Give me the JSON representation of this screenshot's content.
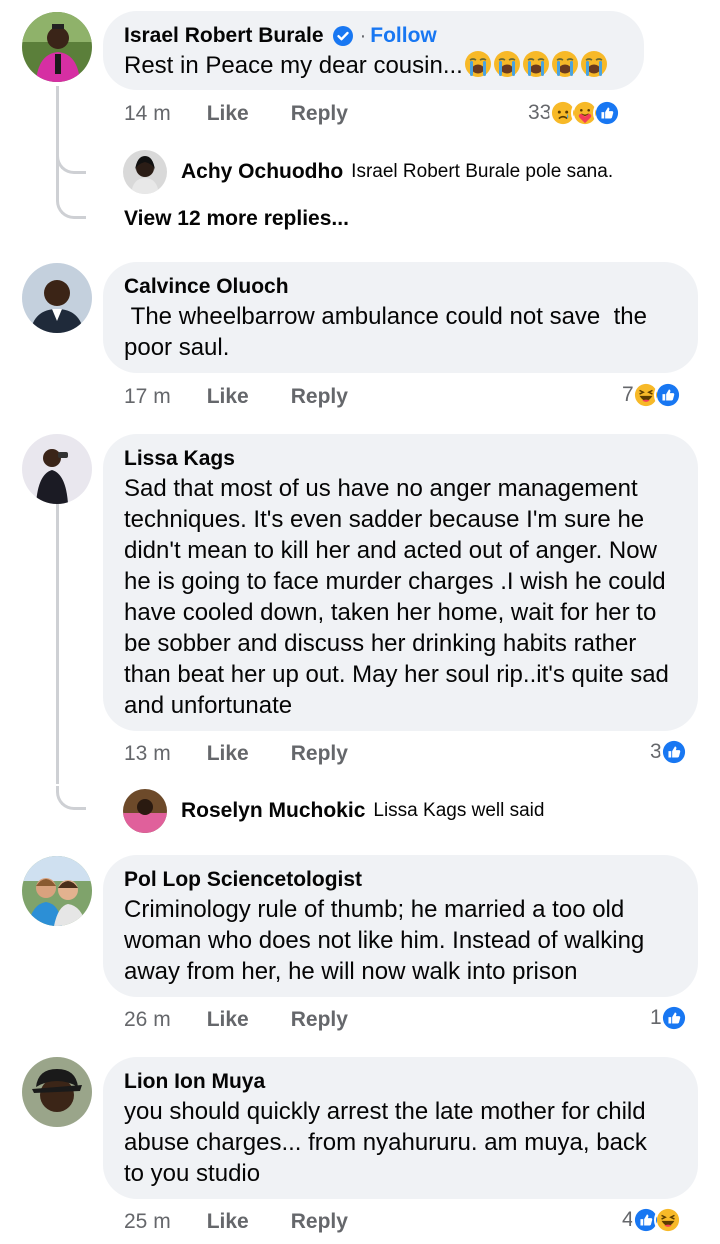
{
  "comments": [
    {
      "author": "Israel Robert Burale",
      "follow_label": "Follow",
      "separator": "·",
      "text": "Rest in Peace my dear cousin...",
      "inline_emoji": [
        "crying-face",
        "crying-face",
        "crying-face",
        "crying-face",
        "crying-face"
      ],
      "time": "14 m",
      "like": "Like",
      "reply": "Reply",
      "reaction_count": "33",
      "reactions": [
        "sad",
        "care",
        "like"
      ],
      "replies": [
        {
          "author": "Achy Ochuodho",
          "text": "Israel Robert Burale pole sana."
        }
      ],
      "view_more": "View 12 more replies..."
    },
    {
      "author": "Calvince Oluoch",
      "text": " The wheelbarrow ambulance could not save  the poor saul.",
      "time": "17 m",
      "like": "Like",
      "reply": "Reply",
      "reaction_count": "7",
      "reactions": [
        "haha",
        "like"
      ]
    },
    {
      "author": "Lissa Kags",
      "text": "Sad that most of us have no anger management techniques. It's even sadder because I'm sure he didn't mean to kill her and acted out of anger. Now he is going to face murder charges .I wish he could have cooled down, taken her home, wait for her to be sobber and discuss her drinking habits rather than beat her up out. May her soul rip..it's quite sad and unfortunate",
      "time": "13 m",
      "like": "Like",
      "reply": "Reply",
      "reaction_count": "3",
      "reactions": [
        "like"
      ],
      "replies": [
        {
          "author": "Roselyn Muchokic",
          "text": "Lissa Kags well said"
        }
      ]
    },
    {
      "author": "Pol Lop Sciencetologist",
      "text": "Criminology rule of thumb; he married a too old woman who does not like him. Instead of walking away from her, he will now walk into prison",
      "time": "26 m",
      "like": "Like",
      "reply": "Reply",
      "reaction_count": "1",
      "reactions": [
        "like"
      ]
    },
    {
      "author": "Lion Ion Muya",
      "text": "you should quickly arrest the late mother for child abuse charges... from nyahururu. am muya, back to you studio",
      "time": "25 m",
      "like": "Like",
      "reply": "Reply",
      "reaction_count": "4",
      "reactions": [
        "like",
        "haha"
      ]
    }
  ],
  "colors": {
    "like_blue": "#1877f2",
    "bubble_bg": "#f0f2f5",
    "meta_grey": "#65676b",
    "reaction_yellow": "#f7b928"
  }
}
